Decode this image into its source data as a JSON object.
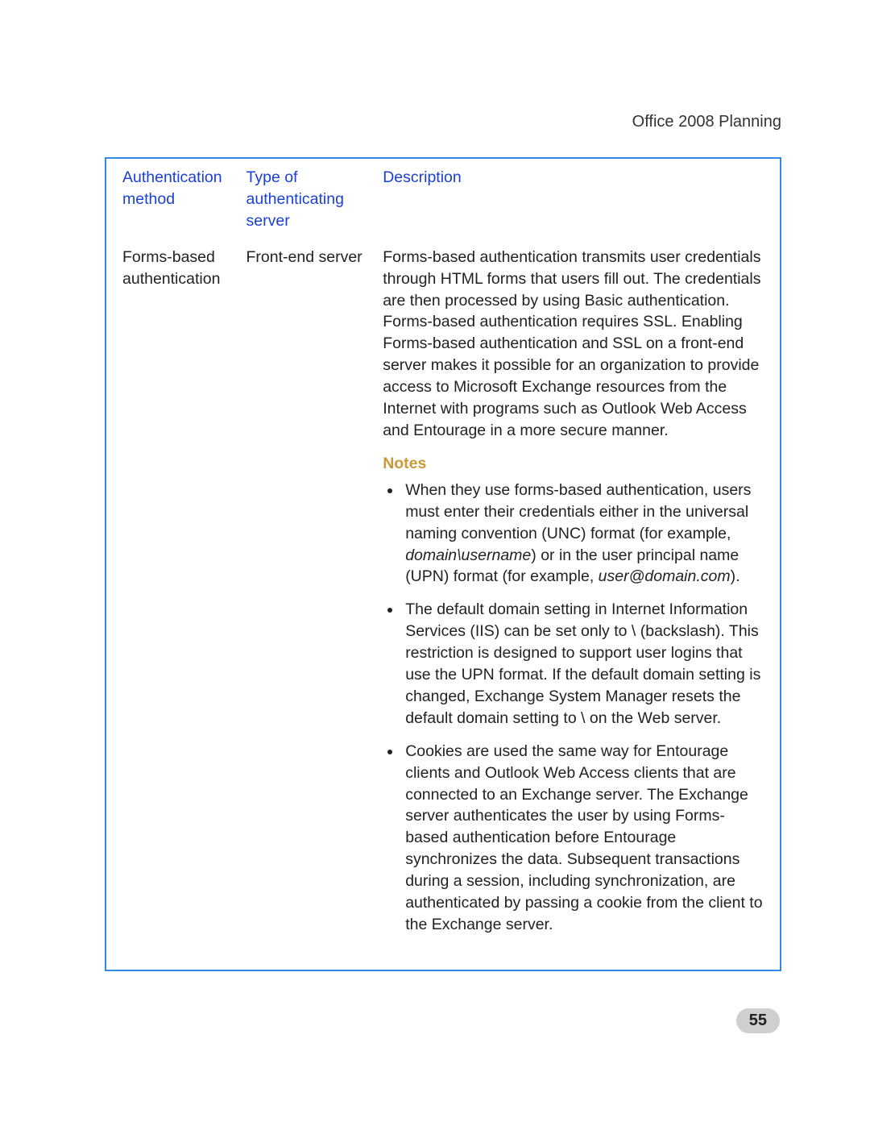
{
  "header": {
    "running_head": "Office 2008 Planning"
  },
  "table": {
    "headers": {
      "col1": "Authentication method",
      "col2": "Type of authenticating server",
      "col3": "Description"
    },
    "row": {
      "method": "Forms-based authentication",
      "server": "Front-end server",
      "desc_main": "Forms-based authentication transmits user credentials through HTML forms that users fill out. The credentials are then processed by using Basic authentication. Forms-based authentication requires SSL. Enabling Forms-based authentication and SSL on a front-end server makes it possible for an organization to provide access to Microsoft Exchange resources from the Internet with programs such as Outlook Web Access and Entourage in a more secure manner.",
      "notes_heading": "Notes",
      "notes": {
        "n1a": "When they use forms-based authentication, users must enter their credentials either in the universal naming convention (UNC) format (for example, ",
        "n1b": "domain\\username",
        "n1c": ") or in the user principal name (UPN) format (for example, ",
        "n1d": "user@domain.com",
        "n1e": ").",
        "n2": "The default domain setting in Internet Information Services (IIS) can be set only to \\ (backslash). This restriction is designed to support user logins that use the UPN format. If the default domain setting is changed, Exchange System Manager resets the default domain setting to \\ on the Web server.",
        "n3": "Cookies are used the same way for Entourage clients and Outlook Web Access clients that are connected to an Exchange server. The Exchange server authenticates the user by using Forms-based authentication before Entourage synchronizes the data. Subsequent transactions during a session, including synchronization, are authenticated by passing a cookie from the client to the Exchange server."
      }
    }
  },
  "footer": {
    "page_number": "55"
  }
}
